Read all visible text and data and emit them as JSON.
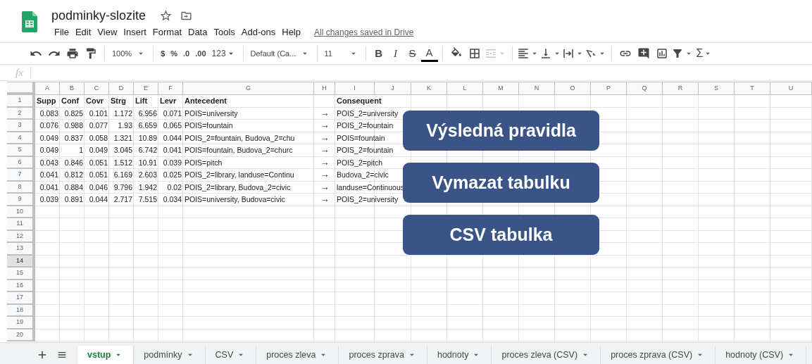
{
  "document": {
    "title": "podminky-slozite",
    "save_status": "All changes saved in Drive"
  },
  "menu": [
    "File",
    "Edit",
    "View",
    "Insert",
    "Format",
    "Data",
    "Tools",
    "Add-ons",
    "Help"
  ],
  "toolbar": {
    "zoom": "100%",
    "currency": "$",
    "percent": "%",
    "decrease_decimals": ".0",
    "increase_decimals": ".00",
    "number_format": "123",
    "font": "Default (Ca...",
    "font_size": "11",
    "bold": "B",
    "italic": "I",
    "strikethrough": "S",
    "text_color": "A",
    "merge_disabled": true,
    "functions": "Σ"
  },
  "formula_bar": {
    "label": "fx"
  },
  "columns": [
    "A",
    "B",
    "C",
    "D",
    "E",
    "F",
    "G",
    "H",
    "I",
    "J",
    "K",
    "L",
    "M",
    "N",
    "O",
    "P",
    "Q",
    "R",
    "S",
    "T",
    "U"
  ],
  "rows": [
    {
      "number": "1",
      "selected": false,
      "kind": "header",
      "cells": [
        "Supp",
        "Conf",
        "Covr",
        "Strg",
        "Lift",
        "Levr",
        "Antecedent",
        null,
        "Consequent"
      ]
    },
    {
      "number": "2",
      "selected": false,
      "kind": "data",
      "cells": [
        "0.083",
        "0.825",
        "0.101",
        "1.172",
        "6.956",
        "0.071",
        "POIS=university",
        "→",
        "POIS_2=university"
      ]
    },
    {
      "number": "3",
      "selected": false,
      "kind": "data",
      "cells": [
        "0.076",
        "0.988",
        "0.077",
        "1.93",
        "6.659",
        "0.065",
        "POIS=fountain",
        "→",
        "POIS_2=fountain"
      ]
    },
    {
      "number": "4",
      "selected": false,
      "kind": "data",
      "cells": [
        "0.049",
        "0.837",
        "0.058",
        "1.321",
        "10.89",
        "0.044",
        "POIS_2=fountain, Budova_2=chu",
        "→",
        "POIS=fountain"
      ]
    },
    {
      "number": "5",
      "selected": false,
      "kind": "data",
      "cells": [
        "0.049",
        "1",
        "0.049",
        "3.045",
        "6.742",
        "0.041",
        "POIS=fountain, Budova_2=churc",
        "→",
        "POIS_2=fountain"
      ]
    },
    {
      "number": "6",
      "selected": false,
      "kind": "data",
      "cells": [
        "0.043",
        "0.846",
        "0.051",
        "1.512",
        "10.91",
        "0.039",
        "POIS=pitch",
        "→",
        "POIS_2=pitch"
      ]
    },
    {
      "number": "7",
      "selected": false,
      "kind": "data",
      "cells": [
        "0.041",
        "0.812",
        "0.051",
        "6.169",
        "2.603",
        "0.025",
        "POIS_2=library, landuse=Continu",
        "→",
        "Budova_2=civic"
      ]
    },
    {
      "number": "8",
      "selected": false,
      "kind": "data",
      "cells": [
        "0.041",
        "0.884",
        "0.046",
        "9.796",
        "1.942",
        "0.02",
        "POIS_2=library, Budova_2=civic",
        "→",
        "landuse=Continuous"
      ]
    },
    {
      "number": "9",
      "selected": false,
      "kind": "data",
      "cells": [
        "0.039",
        "0.891",
        "0.044",
        "2.717",
        "7.515",
        "0.034",
        "POIS=university, Budova=civic",
        "→",
        "POIS_2=university"
      ]
    },
    {
      "number": "10",
      "selected": false
    },
    {
      "number": "11",
      "selected": false
    },
    {
      "number": "12",
      "selected": false
    },
    {
      "number": "13",
      "selected": false
    },
    {
      "number": "14",
      "selected": true
    },
    {
      "number": "15",
      "selected": false
    },
    {
      "number": "16",
      "selected": false
    },
    {
      "number": "17",
      "selected": false
    },
    {
      "number": "18",
      "selected": false
    },
    {
      "number": "19",
      "selected": false
    },
    {
      "number": "20",
      "selected": false
    }
  ],
  "buttons": [
    "Výsledná pravidla",
    "Vymazat tabulku",
    "CSV tabulka"
  ],
  "sheets": [
    {
      "label": "vstup",
      "selected": true
    },
    {
      "label": "podmínky",
      "selected": false
    },
    {
      "label": "CSV",
      "selected": false
    },
    {
      "label": "proces zleva",
      "selected": false
    },
    {
      "label": "proces zprava",
      "selected": false
    },
    {
      "label": "hodnoty",
      "selected": false
    },
    {
      "label": "proces zleva (CSV)",
      "selected": false
    },
    {
      "label": "proces zprava (CSV)",
      "selected": false
    },
    {
      "label": "hodnoty (CSV)",
      "selected": false
    }
  ]
}
